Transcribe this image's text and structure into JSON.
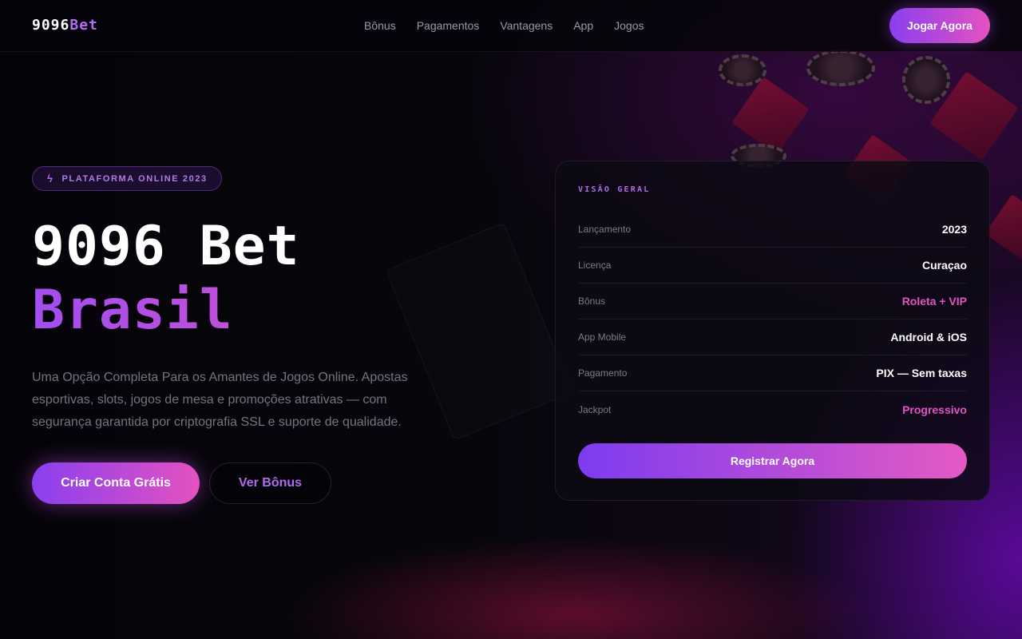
{
  "header": {
    "logo_main": "9096",
    "logo_accent": "Bet",
    "nav": [
      "Bônus",
      "Pagamentos",
      "Vantagens",
      "App",
      "Jogos"
    ],
    "cta_label": "Jogar Agora"
  },
  "hero": {
    "badge": "PLATAFORMA ONLINE 2023",
    "title_line1": "9096 Bet",
    "title_line2": "Brasil",
    "description": "Uma Opção Completa Para os Amantes de Jogos Online. Apostas esportivas, slots, jogos de mesa e promoções atrativas — com segurança garantida por criptografia SSL e suporte de qualidade.",
    "primary_button": "Criar Conta Grátis",
    "secondary_button": "Ver Bônus"
  },
  "overview": {
    "title": "VISÃO GERAL",
    "rows": [
      {
        "label": "Lançamento",
        "value": "2023"
      },
      {
        "label": "Licença",
        "value": "Curaçao"
      },
      {
        "label": "Bônus",
        "value": "Roleta + VIP"
      },
      {
        "label": "App Mobile",
        "value": "Android & iOS"
      },
      {
        "label": "Pagamento",
        "value": "PIX — Sem taxas"
      },
      {
        "label": "Jackpot",
        "value": "Progressivo"
      }
    ],
    "button": "Registrar Agora"
  },
  "colors": {
    "accent_purple": "#8a3ff0",
    "accent_pink": "#e452c0",
    "background": "#07060b"
  }
}
